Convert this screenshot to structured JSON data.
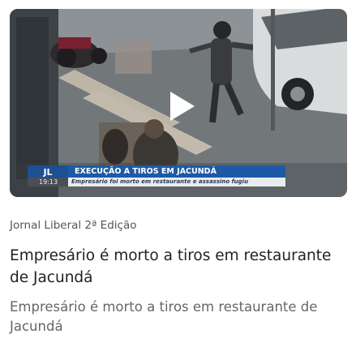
{
  "video": {
    "lower_third": {
      "logo": "JL",
      "time": "19:13",
      "headline": "EXECUÇÃO A TIROS EM JACUNDÁ",
      "subline": "Empresário foi morto em restaurante e assassino fugiu"
    },
    "play_icon": "play-icon"
  },
  "program": "Jornal Liberal 2ª Edição",
  "title": "Empresário é morto a tiros em restaurante de Jacundá",
  "summary": "Empresário é morto a tiros em restaurante de Jacundá",
  "colors": {
    "headline_bar": "#1d5aa6",
    "logo_bg": "#1d4f93",
    "title_text": "#222222",
    "summary_text": "#666666",
    "program_text": "#555555"
  }
}
